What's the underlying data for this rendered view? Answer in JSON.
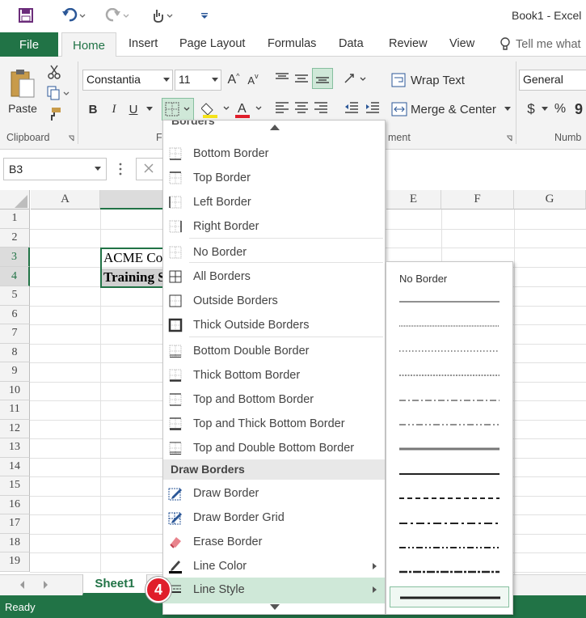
{
  "window": {
    "title": "Book1 - Excel"
  },
  "tabs": [
    {
      "label": "File"
    },
    {
      "label": "Home"
    },
    {
      "label": "Insert"
    },
    {
      "label": "Page Layout"
    },
    {
      "label": "Formulas"
    },
    {
      "label": "Data"
    },
    {
      "label": "Review"
    },
    {
      "label": "View"
    }
  ],
  "tell_me": "Tell me what",
  "ribbon": {
    "paste_label": "Paste",
    "font_name": "Constantia",
    "font_size": "11",
    "bold": "B",
    "italic": "I",
    "underline": "U",
    "wrap_text": "Wrap Text",
    "merge_center": "Merge & Center",
    "number_format": "General",
    "currency": "$",
    "percent": "%",
    "comma": "9",
    "groups": {
      "clipboard": "Clipboard",
      "font": "Fo",
      "alignment": "ment",
      "number": "Numb"
    }
  },
  "formula": {
    "name_box": "B3"
  },
  "grid": {
    "columns": [
      "A",
      "",
      "",
      "",
      "E",
      "F",
      "G"
    ],
    "rows": [
      "1",
      "2",
      "3",
      "4",
      "5",
      "6",
      "7",
      "8",
      "9",
      "10",
      "11",
      "12",
      "13",
      "14",
      "15",
      "16",
      "17",
      "18",
      "19"
    ],
    "cells": {
      "b3": "ACME Co",
      "b4": "Training S"
    }
  },
  "sheet_tab": "Sheet1",
  "status": "Ready",
  "callout": "4",
  "borders_menu": {
    "header_partial": "Borders",
    "items": [
      {
        "label": "Bottom Border"
      },
      {
        "label": "Top Border"
      },
      {
        "label": "Left Border"
      },
      {
        "label": "Right Border"
      },
      {
        "label": "No Border"
      },
      {
        "label": "All Borders"
      },
      {
        "label": "Outside Borders"
      },
      {
        "label": "Thick Outside Borders"
      },
      {
        "label": "Bottom Double Border"
      },
      {
        "label": "Thick Bottom Border"
      },
      {
        "label": "Top and Bottom Border"
      },
      {
        "label": "Top and Thick Bottom Border"
      },
      {
        "label": "Top and Double Bottom Border"
      }
    ],
    "draw_header": "Draw Borders",
    "draw_items": [
      {
        "label": "Draw Border"
      },
      {
        "label": "Draw Border Grid"
      },
      {
        "label": "Erase Border"
      },
      {
        "label": "Line Color"
      },
      {
        "label": "Line Style"
      }
    ]
  },
  "line_style_menu": {
    "no_border": "No Border",
    "styles": [
      "thin",
      "hair",
      "dotted",
      "dashed-fine",
      "dash-dot",
      "dash-dot-dot",
      "medium-thick",
      "medium",
      "dashed",
      "medium-dash-dot",
      "medium-dash-dot-dot",
      "slant-dash-dot",
      "thick"
    ]
  },
  "colors": {
    "accent": "#217346",
    "highlight": "#cfe8d8",
    "callout": "#e01e2b"
  }
}
